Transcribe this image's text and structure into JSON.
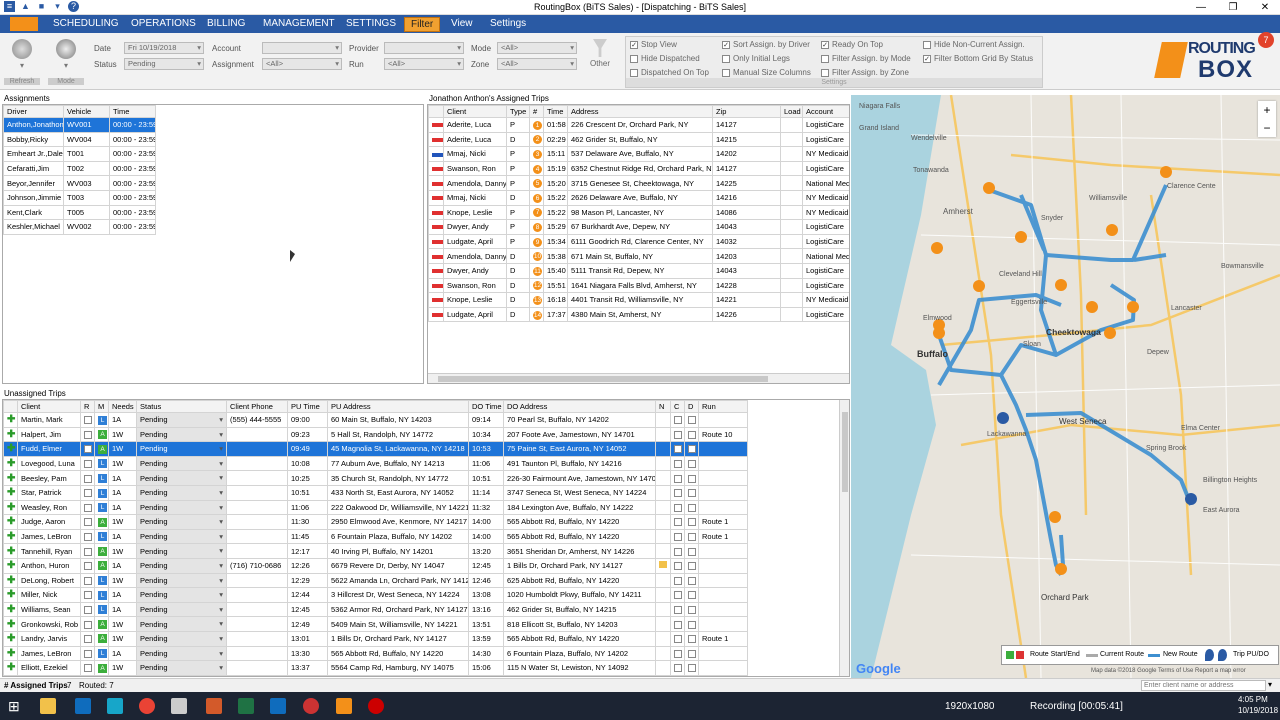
{
  "window": {
    "title": "RoutingBox (BiTS Sales) - [Dispatching - BiTS Sales]"
  },
  "menu": [
    "SCHEDULING",
    "OPERATIONS",
    "BILLING",
    "MANAGEMENT",
    "SETTINGS",
    "Filter",
    "View",
    "Settings"
  ],
  "ribbon": {
    "refresh_label": "Refresh",
    "mode_label": "Mode",
    "other_label": "Other",
    "settings_group_label": "Settings",
    "date_label": "Date",
    "date_value": "Fri  10/19/2018",
    "status_label": "Status",
    "status_value": "Pending",
    "account_label": "Account",
    "assignment_label": "Assignment",
    "assignment_value": "<All>",
    "provider_label": "Provider",
    "run_label": "Run",
    "run_value": "<All>",
    "mode_field_label": "Mode",
    "mode_value": "<All>",
    "zone_label": "Zone",
    "zone_value": "<All>",
    "checks": [
      {
        "label": "Stop View",
        "checked": true
      },
      {
        "label": "Hide Dispatched",
        "checked": false
      },
      {
        "label": "Dispatched On Top",
        "checked": false
      },
      {
        "label": "Sort Assign. by Driver",
        "checked": true
      },
      {
        "label": "Only Initial Legs",
        "checked": false
      },
      {
        "label": "Manual Size Columns",
        "checked": false
      },
      {
        "label": "Ready On Top",
        "checked": true
      },
      {
        "label": "Filter Assign. by Mode",
        "checked": false
      },
      {
        "label": "Filter Assign. by Zone",
        "checked": false
      },
      {
        "label": "Hide Non-Current Assign.",
        "checked": false
      },
      {
        "label": "Filter Bottom Grid By Status",
        "checked": true
      }
    ]
  },
  "logo": {
    "line1": "ROUTING",
    "line2": "BOX",
    "badge": "7"
  },
  "assignments": {
    "title": "Assignments",
    "columns": [
      "Driver",
      "Vehicle",
      "Time"
    ],
    "rows": [
      [
        "Anthon,Jonathon",
        "WV001",
        "00:00 - 23:59"
      ],
      [
        "Bobby,Ricky",
        "WV004",
        "00:00 - 23:59"
      ],
      [
        "Emheart Jr.,Dale",
        "T001",
        "00:00 - 23:59"
      ],
      [
        "Cefaratti,Jim",
        "T002",
        "00:00 - 23:59"
      ],
      [
        "Beyor,Jennifer",
        "WV003",
        "00:00 - 23:59"
      ],
      [
        "Johnson,Jimmie",
        "T003",
        "00:00 - 23:59"
      ],
      [
        "Kent,Clark",
        "T005",
        "00:00 - 23:59"
      ],
      [
        "Keshler,Michael",
        "WV002",
        "00:00 - 23:59"
      ]
    ]
  },
  "trips": {
    "title": "Jonathon Anthon's Assigned Trips",
    "columns": [
      "",
      "Client",
      "Type",
      "#",
      "Time",
      "Address",
      "Zip",
      "Load",
      "Account"
    ],
    "rows": [
      [
        "Aderite, Luca",
        "P",
        "1",
        "01:58",
        "226 Crescent Dr, Orchard Park, NY",
        "14127",
        "",
        "LogistiCare"
      ],
      [
        "Aderite, Luca",
        "D",
        "2",
        "02:29",
        "462 Grider St, Buffalo, NY",
        "14215",
        "",
        "LogistiCare"
      ],
      [
        "Mmaj, Nicki",
        "P",
        "3",
        "15:11",
        "537 Delaware Ave, Buffalo, NY",
        "14202",
        "",
        "NY Medicaid"
      ],
      [
        "Swanson, Ron",
        "P",
        "4",
        "15:19",
        "6352 Chestnut Ridge Rd, Orchard Park, NY",
        "14127",
        "",
        "LogistiCare"
      ],
      [
        "Amendola, Danny",
        "P",
        "5",
        "15:20",
        "3715 Genesee St, Cheektowaga, NY",
        "14225",
        "",
        "National MedT"
      ],
      [
        "Mmaj, Nicki",
        "D",
        "6",
        "15:22",
        "2626 Delaware Ave, Buffalo, NY",
        "14216",
        "",
        "NY Medicaid"
      ],
      [
        "Knope, Leslie",
        "P",
        "7",
        "15:22",
        "98 Mason Pl, Lancaster, NY",
        "14086",
        "",
        "NY Medicaid"
      ],
      [
        "Dwyer, Andy",
        "P",
        "8",
        "15:29",
        "67 Burkhardt Ave, Depew, NY",
        "14043",
        "",
        "LogistiCare"
      ],
      [
        "Ludgate, April",
        "P",
        "9",
        "15:34",
        "6111 Goodrich Rd, Clarence Center, NY",
        "14032",
        "",
        "LogistiCare"
      ],
      [
        "Amendola, Danny",
        "D",
        "10",
        "15:38",
        "671 Main St, Buffalo, NY",
        "14203",
        "",
        "National MedT"
      ],
      [
        "Dwyer, Andy",
        "D",
        "11",
        "15:40",
        "5111 Transit Rd, Depew, NY",
        "14043",
        "",
        "LogistiCare"
      ],
      [
        "Swanson, Ron",
        "D",
        "12",
        "15:51",
        "1641 Niagara Falls Blvd, Amherst, NY",
        "14228",
        "",
        "LogistiCare"
      ],
      [
        "Knope, Leslie",
        "D",
        "13",
        "16:18",
        "4401 Transit Rd, Williamsville, NY",
        "14221",
        "",
        "NY Medicaid"
      ],
      [
        "Ludgate, April",
        "D",
        "14",
        "17:37",
        "4380 Main St, Amherst, NY",
        "14226",
        "",
        "LogistiCare"
      ]
    ]
  },
  "unassigned": {
    "title": "Unassigned Trips",
    "columns": [
      "",
      "Client",
      "R",
      "M",
      "Needs",
      "Status",
      "Client Phone",
      "PU Time",
      "PU Address",
      "DO Time",
      "DO Address",
      "N",
      "C",
      "D",
      "Run"
    ],
    "rows": [
      [
        "Martin, Mark",
        "L",
        "1A",
        "Pending",
        "(555) 444-5555",
        "09:00",
        "60 Main St, Buffalo, NY 14203",
        "09:14",
        "70 Pearl St, Buffalo, NY 14202",
        ""
      ],
      [
        "Halpert, Jim",
        "A",
        "1W",
        "Pending",
        "",
        "09:23",
        "5 Hall St, Randolph, NY 14772",
        "10:34",
        "207 Foote Ave, Jamestown, NY 14701",
        "Route 10"
      ],
      [
        "Fudd, Elmer",
        "A",
        "1W",
        "Pending",
        "",
        "09:49",
        "45 Magnolia St, Lackawanna, NY 14218",
        "10:53",
        "75 Paine St, East Aurora, NY 14052",
        ""
      ],
      [
        "Lovegood, Luna",
        "L",
        "1W",
        "Pending",
        "",
        "10:08",
        "77 Auburn Ave, Buffalo, NY 14213",
        "11:06",
        "491 Taunton Pl, Buffalo, NY 14216",
        ""
      ],
      [
        "Beesley, Pam",
        "L",
        "1A",
        "Pending",
        "",
        "10:25",
        "35 Church St, Randolph, NY 14772",
        "10:51",
        "226-30 Fairmount Ave, Jamestown, NY 14701",
        ""
      ],
      [
        "Star, Patrick",
        "L",
        "1A",
        "Pending",
        "",
        "10:51",
        "433 North St, East Aurora, NY 14052",
        "11:14",
        "3747 Seneca St, West Seneca, NY 14224",
        ""
      ],
      [
        "Weasley, Ron",
        "L",
        "1A",
        "Pending",
        "",
        "11:06",
        "222 Oakwood Dr, Williamsville, NY 14221",
        "11:32",
        "184 Lexington Ave, Buffalo, NY 14222",
        ""
      ],
      [
        "Judge, Aaron",
        "A",
        "1W",
        "Pending",
        "",
        "11:30",
        "2950 Elmwood Ave, Kenmore, NY 14217",
        "14:00",
        "565 Abbott Rd, Buffalo, NY 14220",
        "Route 1"
      ],
      [
        "James, LeBron",
        "L",
        "1A",
        "Pending",
        "",
        "11:45",
        "6 Fountain Plaza, Buffalo, NY 14202",
        "14:00",
        "565 Abbott Rd, Buffalo, NY 14220",
        "Route 1"
      ],
      [
        "Tannehill, Ryan",
        "A",
        "1W",
        "Pending",
        "",
        "12:17",
        "40 Irving Pl, Buffalo, NY 14201",
        "13:20",
        "3651 Sheridan Dr, Amherst, NY 14226",
        ""
      ],
      [
        "Anthon, Huron",
        "A",
        "1A",
        "Pending",
        "(716) 710-0686",
        "12:26",
        "6679 Revere Dr, Derby, NY 14047",
        "12:45",
        "1 Bills Dr, Orchard Park, NY 14127",
        ""
      ],
      [
        "DeLong, Robert",
        "L",
        "1W",
        "Pending",
        "",
        "12:29",
        "5622 Amanda Ln, Orchard Park, NY 14127",
        "12:46",
        "625 Abbott Rd, Buffalo, NY 14220",
        ""
      ],
      [
        "Miller, Nick",
        "L",
        "1A",
        "Pending",
        "",
        "12:44",
        "3 Hillcrest Dr, West Seneca, NY 14224",
        "13:08",
        "1020 Humboldt Pkwy, Buffalo, NY 14211",
        ""
      ],
      [
        "Williams, Sean",
        "L",
        "1A",
        "Pending",
        "",
        "12:45",
        "5362 Armor Rd, Orchard Park, NY 14127",
        "13:16",
        "462 Grider St, Buffalo, NY 14215",
        ""
      ],
      [
        "Gronkowski, Rob",
        "A",
        "1W",
        "Pending",
        "",
        "12:49",
        "5409 Main St, Williamsville, NY 14221",
        "13:51",
        "818 Ellicott St, Buffalo, NY 14203",
        ""
      ],
      [
        "Landry, Jarvis",
        "A",
        "1W",
        "Pending",
        "",
        "13:01",
        "1 Bills Dr, Orchard Park, NY 14127",
        "13:59",
        "565 Abbott Rd, Buffalo, NY 14220",
        "Route 1"
      ],
      [
        "James, LeBron",
        "L",
        "1A",
        "Pending",
        "",
        "13:30",
        "565 Abbott Rd, Buffalo, NY 14220",
        "14:30",
        "6 Fountain Plaza, Buffalo, NY 14202",
        ""
      ],
      [
        "Elliott, Ezekiel",
        "A",
        "1W",
        "Pending",
        "",
        "13:37",
        "5564 Camp Rd, Hamburg, NY 14075",
        "15:06",
        "115 N Water St, Lewiston, NY 14092",
        ""
      ]
    ]
  },
  "map": {
    "places": [
      "Clarence Cente",
      "Williamsville",
      "Amherst",
      "Cheektowaga",
      "Buffalo",
      "West Seneca",
      "Lackawanna",
      "Elma Center",
      "East Aurora",
      "Spring Brook",
      "Billington Heights",
      "Cleveland Hill",
      "Eggertsville",
      "Sloan",
      "Elmwood",
      "Orchard Park",
      "Lancaster",
      "Depew",
      "Bowmansville",
      "Wendelville",
      "Snyder",
      "Tonawanda",
      "Grand Island",
      "Niagara Falls"
    ],
    "legend": {
      "start_end": "Route Start/End",
      "current": "Current Route",
      "new": "New Route",
      "trip": "Trip PU/DO"
    },
    "attrib": "Map data ©2018 Google  Terms of Use  Report a map error",
    "google": "Google",
    "search_placeholder": "Enter client name or address"
  },
  "statusbar": {
    "assigned_label": "# Assigned Trips",
    "assigned_value": "7",
    "routed": "Routed: 7"
  },
  "taskbar": {
    "resolution": "1920x1080",
    "recording": "Recording [00:05:41]",
    "time": "4:05 PM",
    "date": "10/19/2018"
  }
}
